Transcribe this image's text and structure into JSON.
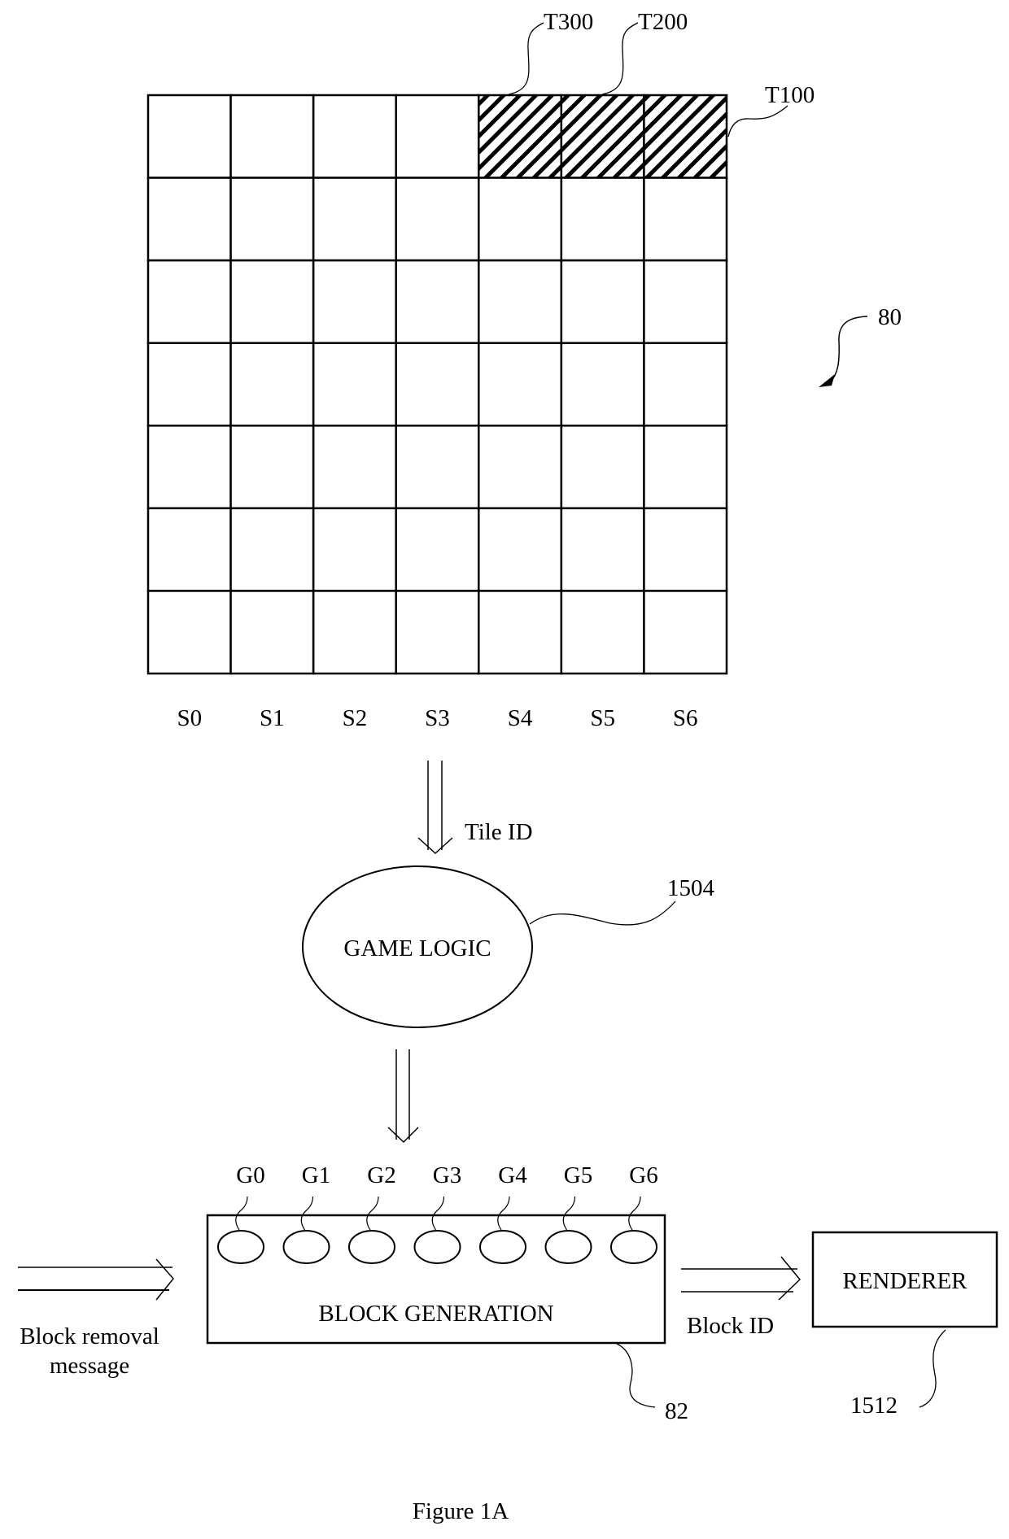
{
  "figure": {
    "caption": "Figure 1A",
    "ref_grid": "80",
    "colors": {
      "ink": "#000000",
      "paper": "#ffffff"
    }
  },
  "grid": {
    "rows": 7,
    "cols": 7,
    "column_labels": [
      "S0",
      "S1",
      "S2",
      "S3",
      "S4",
      "S5",
      "S6"
    ],
    "highlighted_tiles": [
      {
        "label": "T300",
        "row": 0,
        "col": 4
      },
      {
        "label": "T200",
        "row": 0,
        "col": 5
      },
      {
        "label": "T100",
        "row": 0,
        "col": 6
      }
    ]
  },
  "flow": {
    "tile_id_label": "Tile ID",
    "game_logic": {
      "label": "GAME LOGIC",
      "ref": "1504"
    },
    "block_generation": {
      "label": "BLOCK GENERATION",
      "ref": "82",
      "generators": [
        "G0",
        "G1",
        "G2",
        "G3",
        "G4",
        "G5",
        "G6"
      ]
    },
    "input_label_line1": "Block removal",
    "input_label_line2": "message",
    "output_label": "Block ID",
    "renderer": {
      "label": "RENDERER",
      "ref": "1512"
    }
  }
}
